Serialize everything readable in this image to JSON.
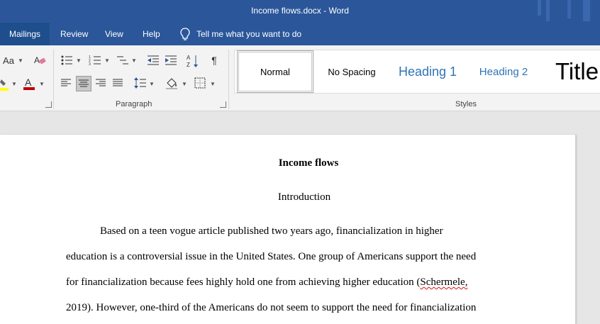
{
  "window": {
    "title": "Income flows.docx  -  Word"
  },
  "tabs": [
    "Mailings",
    "Review",
    "View",
    "Help"
  ],
  "tell_me": "Tell me what you want to do",
  "ribbon": {
    "font_case_label": "Aa",
    "paragraph_label": "Paragraph",
    "styles_label": "Styles",
    "styles": [
      "Normal",
      "No Spacing",
      "Heading 1",
      "Heading 2",
      "Title"
    ],
    "selected_style": "Normal",
    "colors": {
      "highlight": "#ffff00",
      "font_color": "#c00000",
      "heading": "#2e74b5",
      "accent": "#2b579a"
    }
  },
  "document": {
    "title": "Income flows",
    "subtitle": "Introduction",
    "lines": [
      "Based on a teen vogue article published two years ago, financialization in higher",
      "education is a controversial issue in the United States. One group of Americans support the need",
      "for financialization because fees highly hold one from achieving higher education (",
      "2019).  However, one-third of the Americans do not seem to support the need for financialization"
    ],
    "misspelled": "Schermele,"
  }
}
